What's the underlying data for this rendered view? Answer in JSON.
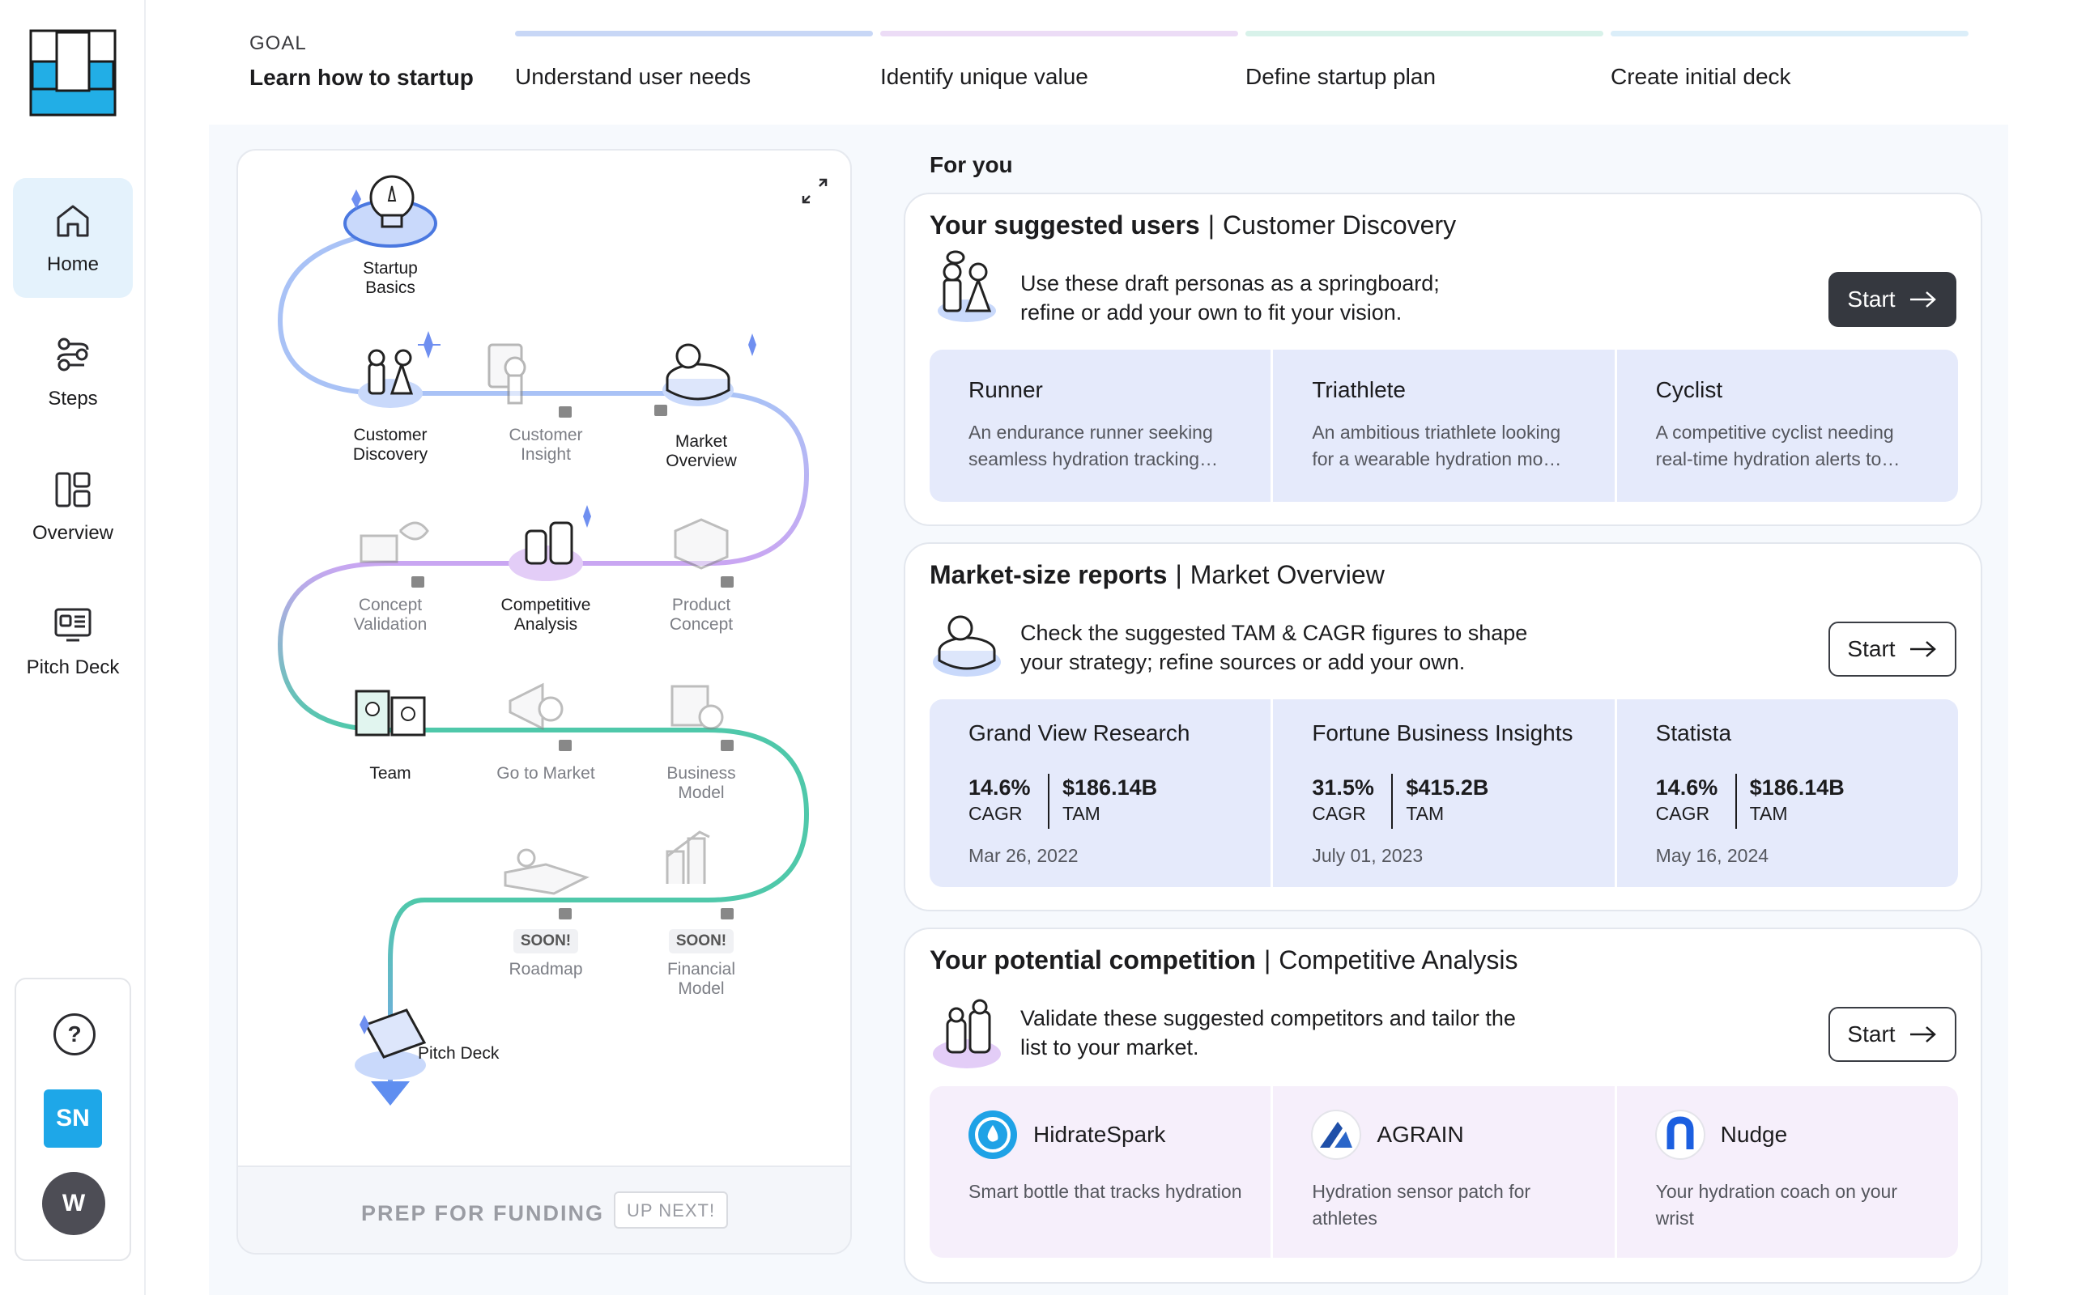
{
  "sidebar": {
    "items": [
      {
        "label": "Home",
        "active": true
      },
      {
        "label": "Steps"
      },
      {
        "label": "Overview"
      },
      {
        "label": "Pitch Deck"
      }
    ],
    "help_icon": "?",
    "user_initials": "SN",
    "workspace_initial": "W"
  },
  "header": {
    "goal_label": "GOAL",
    "goal_title": "Learn how to startup",
    "steps": [
      {
        "label": "Understand user needs",
        "color": "#c8d7f6"
      },
      {
        "label": "Identify unique value",
        "color": "#ecdcf6"
      },
      {
        "label": "Define startup plan",
        "color": "#d8f2ea"
      },
      {
        "label": "Create initial deck",
        "color": "#dbeef9"
      }
    ]
  },
  "journey": {
    "nodes": [
      {
        "label": "Startup\nBasics"
      },
      {
        "label": "Customer\nDiscovery"
      },
      {
        "label": "Customer\nInsight"
      },
      {
        "label": "Market\nOverview"
      },
      {
        "label": "Concept\nValidation"
      },
      {
        "label": "Competitive\nAnalysis"
      },
      {
        "label": "Product\nConcept"
      },
      {
        "label": "Team"
      },
      {
        "label": "Go to Market"
      },
      {
        "label": "Business\nModel"
      },
      {
        "label": "Roadmap",
        "badge": "SOON!"
      },
      {
        "label": "Financial\nModel",
        "badge": "SOON!"
      },
      {
        "label": "Pitch Deck"
      }
    ],
    "footer_title": "PREP FOR FUNDING",
    "footer_badge": "UP NEXT!"
  },
  "for_you": {
    "heading": "For you",
    "start_label": "Start",
    "cards": [
      {
        "title": "Your suggested users",
        "subtitle": "Customer Discovery",
        "description": "Use these draft personas as a springboard;\nrefine or add your own to fit your vision.",
        "tiles": [
          {
            "name": "Runner",
            "desc": "An endurance runner seeking seamless hydration tracking…"
          },
          {
            "name": "Triathlete",
            "desc": "An ambitious triathlete looking for a wearable hydration mo…"
          },
          {
            "name": "Cyclist",
            "desc": "A competitive cyclist needing real-time hydration alerts to…"
          }
        ]
      },
      {
        "title": "Market-size reports",
        "subtitle": "Market Overview",
        "description": "Check the suggested TAM & CAGR figures to shape\nyour strategy; refine sources or add your own.",
        "tiles": [
          {
            "name": "Grand View Research",
            "cagr": "14.6%",
            "cagr_label": "CAGR",
            "tam": "$186.14B",
            "tam_label": "TAM",
            "date": "Mar 26, 2022"
          },
          {
            "name": "Fortune Business Insights",
            "cagr": "31.5%",
            "cagr_label": "CAGR",
            "tam": "$415.2B",
            "tam_label": "TAM",
            "date": "July 01, 2023"
          },
          {
            "name": "Statista",
            "cagr": "14.6%",
            "cagr_label": "CAGR",
            "tam": "$186.14B",
            "tam_label": "TAM",
            "date": "May 16, 2024"
          }
        ]
      },
      {
        "title": "Your potential competition",
        "subtitle": "Competitive Analysis",
        "description": "Validate these suggested competitors and tailor the\nlist to your market.",
        "tiles": [
          {
            "name": "HidrateSpark",
            "desc": "Smart bottle that tracks hydration",
            "logo": "droplet-logo-icon"
          },
          {
            "name": "AGRAIN",
            "desc": "Hydration sensor patch for athletes",
            "logo": "agrain-logo-icon"
          },
          {
            "name": "Nudge",
            "desc": "Your hydration coach on your wrist",
            "logo": "nudge-logo-icon"
          }
        ]
      }
    ]
  },
  "colors": {
    "accent_blue": "#1ea7e8",
    "path_blue": "#a9c2f6",
    "path_purple": "#c9a6f2",
    "path_teal": "#4fc8aa",
    "dark_button": "#35383f"
  }
}
